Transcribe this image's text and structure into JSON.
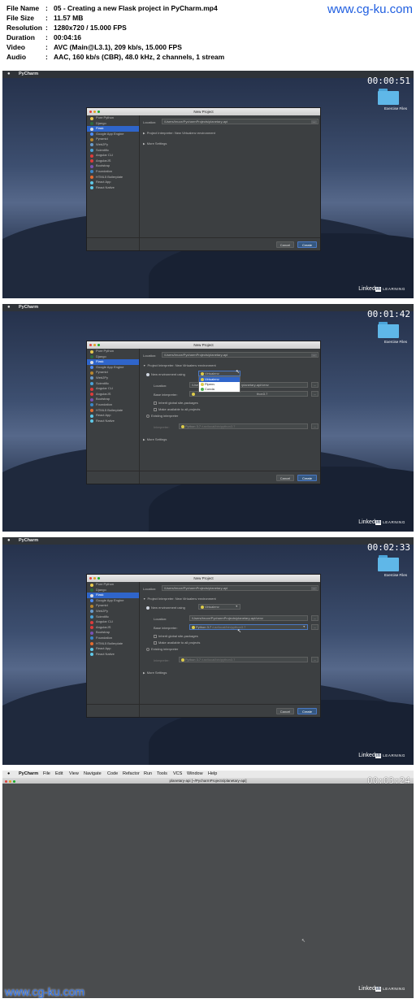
{
  "header": {
    "rows": [
      {
        "key": "File Name",
        "value": "05 - Creating a new Flask project in PyCharm.mp4"
      },
      {
        "key": "File Size",
        "value": "11.57 MB"
      },
      {
        "key": "Resolution",
        "value": "1280x720 / 15.000 FPS"
      },
      {
        "key": "Duration",
        "value": "00:04:16"
      },
      {
        "key": "Video",
        "value": "AVC (Main@L3.1), 209 kb/s, 15.000 FPS"
      },
      {
        "key": "Audio",
        "value": "AAC, 160 kb/s (CBR), 48.0 kHz, 2 channels, 1 stream"
      }
    ],
    "colon": ":"
  },
  "watermark": {
    "top": "www.cg-ku.com",
    "bottom": "www.cg-ku.com"
  },
  "desktop": {
    "menubar_app": "PyCharm",
    "folder_label": "Exercise Files",
    "brand_linked": "Linked",
    "brand_in": "in",
    "brand_learning": "LEARNING"
  },
  "frames": [
    {
      "timestamp": "00:00:51"
    },
    {
      "timestamp": "00:01:42"
    },
    {
      "timestamp": "00:02:33"
    },
    {
      "timestamp": "00:03:24"
    }
  ],
  "dialog": {
    "title": "New Project",
    "project_types": [
      "Pure Python",
      "Django",
      "Flask",
      "Google App Engine",
      "Pyramid",
      "Web2Py",
      "Scientific",
      "Angular CLI",
      "AngularJS",
      "Bootstrap",
      "Foundation",
      "HTML5 Boilerplate",
      "React App",
      "React Native"
    ],
    "selected_type": "Flask",
    "location_label": "Location:",
    "location_value": "/Users/bruce/PycharmProjects/planetary-api",
    "interpreter_label": "Project Interpreter: New Virtualenv environment",
    "more_settings": "More Settings",
    "new_env_label": "New environment using",
    "env_tool": "Virtualenv",
    "env_options": [
      "Virtualenv",
      "Pipenv",
      "Conda"
    ],
    "env_location_label": "Location:",
    "env_location_value": "/Users/bruce/PycharmProjects/planetary-api/venv",
    "env_location_partial_left": "/Use",
    "env_location_partial_right": "/planetary-api/venv",
    "base_interp_label": "Base interpreter:",
    "base_interp_value": "Python 3.7",
    "base_interp_path": "/usr/local/bin/python3.7",
    "base_interp_partial": "thon3.7",
    "inherit_label": "Inherit global site-packages",
    "available_label": "Make available to all projects",
    "existing_label": "Existing interpreter",
    "existing_interp_label": "Interpreter:",
    "existing_interp_value": "Python 3.7",
    "existing_interp_path": "/usr/local/bin/python3.7",
    "cancel": "Cancel",
    "create": "Create",
    "browse": "..."
  },
  "ide": {
    "menu": [
      "PyCharm",
      "File",
      "Edit",
      "View",
      "Navigate",
      "Code",
      "Refactor",
      "Run",
      "Tools",
      "VCS",
      "Window",
      "Help"
    ],
    "window_title": "planetary-api [~/PycharmProjects/planetary-api]"
  }
}
